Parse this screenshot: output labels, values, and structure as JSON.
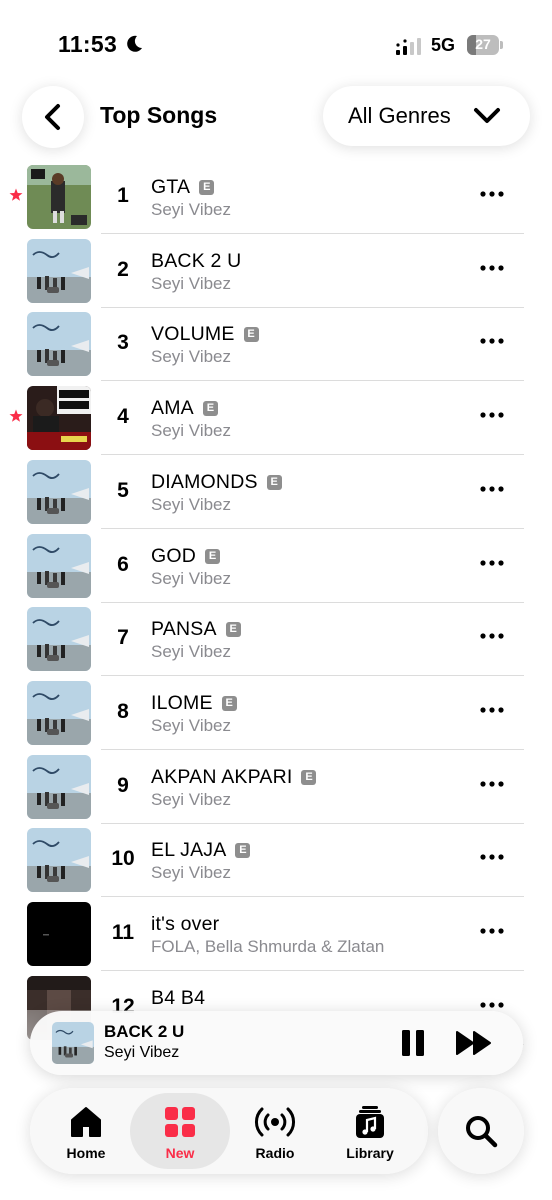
{
  "status_bar": {
    "time": "11:53",
    "network": "5G",
    "battery": "27",
    "battery_level": 0.27
  },
  "header": {
    "back_icon": "chevron-left-icon",
    "title": "Top Songs",
    "genre_label": "All Genres",
    "genre_icon": "chevron-down-icon"
  },
  "explicit_badge": "E",
  "songs": [
    {
      "rank": "1",
      "title": "GTA",
      "artist": "Seyi Vibez",
      "explicit": true,
      "starred": true,
      "art": "gta"
    },
    {
      "rank": "2",
      "title": "BACK 2 U",
      "artist": "Seyi Vibez",
      "explicit": false,
      "starred": false,
      "art": "sky"
    },
    {
      "rank": "3",
      "title": "VOLUME",
      "artist": "Seyi Vibez",
      "explicit": true,
      "starred": false,
      "art": "sky"
    },
    {
      "rank": "4",
      "title": "AMA",
      "artist": "Seyi Vibez",
      "explicit": true,
      "starred": true,
      "art": "fuji"
    },
    {
      "rank": "5",
      "title": "DIAMONDS",
      "artist": "Seyi Vibez",
      "explicit": true,
      "starred": false,
      "art": "sky"
    },
    {
      "rank": "6",
      "title": "GOD",
      "artist": "Seyi Vibez",
      "explicit": true,
      "starred": false,
      "art": "sky"
    },
    {
      "rank": "7",
      "title": "PANSA",
      "artist": "Seyi Vibez",
      "explicit": true,
      "starred": false,
      "art": "sky"
    },
    {
      "rank": "8",
      "title": "ILOME",
      "artist": "Seyi Vibez",
      "explicit": true,
      "starred": false,
      "art": "sky"
    },
    {
      "rank": "9",
      "title": "AKPAN AKPARI",
      "artist": "Seyi Vibez",
      "explicit": true,
      "starred": false,
      "art": "sky"
    },
    {
      "rank": "10",
      "title": "EL JAJA",
      "artist": "Seyi Vibez",
      "explicit": true,
      "starred": false,
      "art": "sky"
    },
    {
      "rank": "11",
      "title": "it's over",
      "artist": "FOLA, Bella Shmurda & Zlatan",
      "explicit": false,
      "starred": false,
      "art": "black"
    },
    {
      "rank": "12",
      "title": "B4 B4",
      "artist": "",
      "explicit": false,
      "starred": false,
      "art": "dark"
    }
  ],
  "now_playing": {
    "title": "BACK 2 U",
    "artist": "Seyi Vibez",
    "pause_icon": "pause-icon",
    "forward_icon": "fast-forward-icon"
  },
  "tabs": [
    {
      "label": "Home",
      "icon": "home-icon",
      "active": false
    },
    {
      "label": "New",
      "icon": "new-grid-icon",
      "active": true
    },
    {
      "label": "Radio",
      "icon": "radio-icon",
      "active": false
    },
    {
      "label": "Library",
      "icon": "library-icon",
      "active": false
    }
  ],
  "search_icon": "search-icon",
  "colors": {
    "accent": "#fa2d48",
    "secondary_text": "#8a8a8f",
    "explicit_badge": "#8e8e8e",
    "divider": "#dcdcdc"
  }
}
